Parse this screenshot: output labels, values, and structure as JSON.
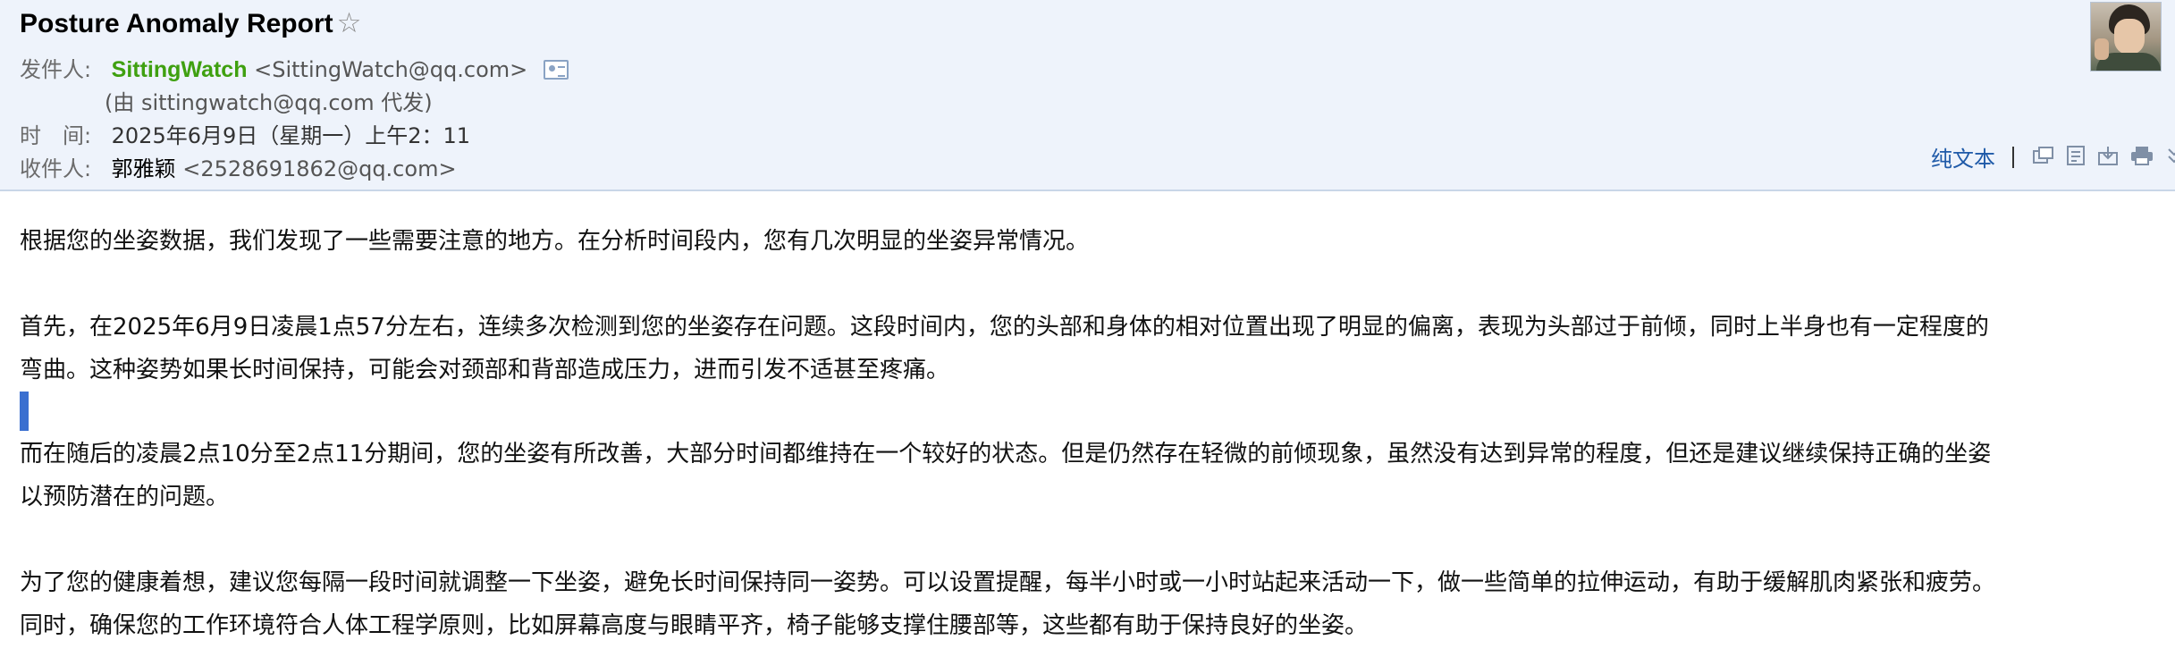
{
  "email": {
    "subject": "Posture Anomaly Report",
    "star": "☆",
    "from_label": "发件人:",
    "sender_name": "SittingWatch",
    "sender_email": "<SittingWatch@qq.com>",
    "proxy_note": "(由 sittingwatch@qq.com 代发)",
    "time_label": "时　间:",
    "time_value": "2025年6月9日（星期一）上午2：11",
    "to_label": "收件人:",
    "recipient_name": "郭雅颖",
    "recipient_email": "<2528691862@qq.com>"
  },
  "toolbar": {
    "plain_text_label": "纯文本",
    "icons": [
      "new-window-icon",
      "note-icon",
      "download-icon",
      "print-icon",
      "expand-more-icon"
    ]
  },
  "body": {
    "paragraphs": [
      "根据您的坐姿数据，我们发现了一些需要注意的地方。在分析时间段内，您有几次明显的坐姿异常情况。",
      "首先，在2025年6月9日凌晨1点57分左右，连续多次检测到您的坐姿存在问题。这段时间内，您的头部和身体的相对位置出现了明显的偏离，表现为头部过于前倾，同时上半身也有一定程度的",
      "弯曲。这种姿势如果长时间保持，可能会对颈部和背部造成压力，进而引发不适甚至疼痛。",
      "而在随后的凌晨2点10分至2点11分期间，您的坐姿有所改善，大部分时间都维持在一个较好的状态。但是仍然存在轻微的前倾现象，虽然没有达到异常的程度，但还是建议继续保持正确的坐姿",
      "以预防潜在的问题。",
      "为了您的健康着想，建议您每隔一段时间就调整一下坐姿，避免长时间保持同一姿势。可以设置提醒，每半小时或一小时站起来活动一下，做一些简单的拉伸运动，有助于缓解肌肉紧张和疲劳。",
      "同时，确保您的工作环境符合人体工程学原则，比如屏幕高度与眼睛平齐，椅子能够支撑住腰部等，这些都有助于保持良好的坐姿。"
    ]
  },
  "colors": {
    "header_bg": "#eef3fb",
    "sender_green": "#3fa010",
    "link_blue": "#1f5aa8",
    "caret_blue": "#3a6fd0"
  }
}
